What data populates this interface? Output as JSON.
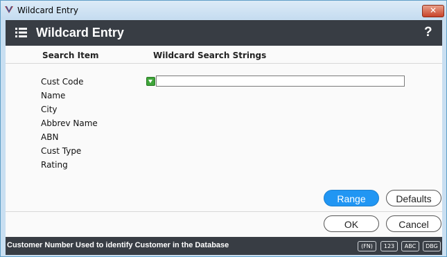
{
  "window": {
    "title": "Wildcard Entry",
    "close_label": "✕"
  },
  "header": {
    "title": "Wildcard Entry",
    "help_label": "?"
  },
  "columns": {
    "search_item": "Search Item",
    "wildcard_strings": "Wildcard Search Strings"
  },
  "fields": [
    "Cust Code",
    "Name",
    "City",
    "Abbrev Name",
    "ABN",
    "Cust Type",
    "Rating"
  ],
  "input": {
    "value": "",
    "placeholder": ""
  },
  "buttons": {
    "range": "Range",
    "defaults": "Defaults",
    "ok": "OK",
    "cancel": "Cancel"
  },
  "status": {
    "text": "Customer Number  Used to identify Customer in the Database",
    "badges": [
      "(FN)",
      "123",
      "ABC",
      "DBG"
    ]
  },
  "colors": {
    "accent": "#2196f3",
    "header_bg": "#383d44",
    "indicator": "#3fa53a"
  },
  "icons": {
    "app": "app-logo-icon",
    "header": "list-icon",
    "help": "help-icon",
    "field_indicator": "dropdown-arrow-icon"
  }
}
